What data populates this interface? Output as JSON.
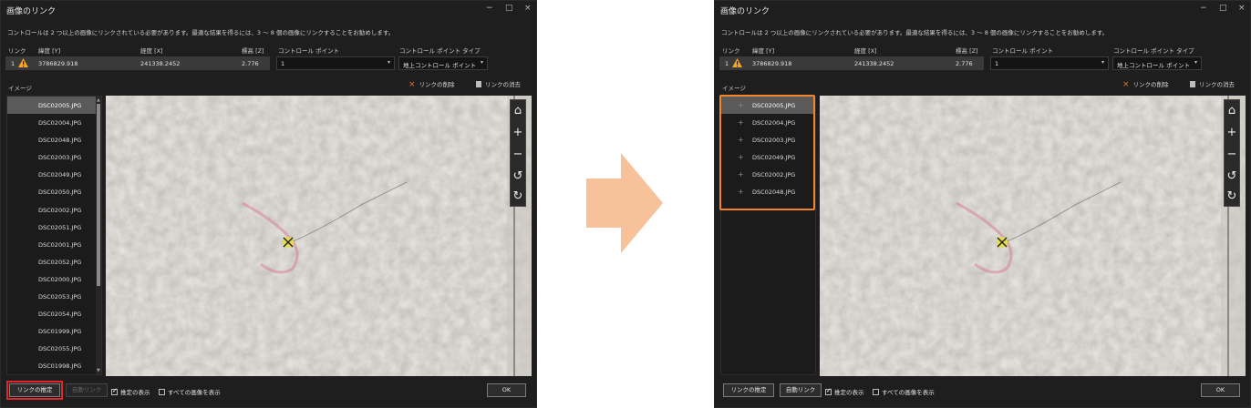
{
  "dialog": {
    "title": "画像のリンク",
    "window_controls": {
      "minimize": "−",
      "maximize": "□",
      "close": "×"
    },
    "info_text": "コントロールは 2 つ以上の画像にリンクされている必要があります。最適な結果を得るには、3 〜 8 個の画像にリンクすることをお勧めします。",
    "columns": {
      "link": "リンク",
      "lat": "緯度 [Y]",
      "lon": "経度 [X]",
      "elev": "標高 [Z]",
      "point": "コントロール ポイント",
      "type": "コントロール ポイント タイプ"
    },
    "row": {
      "link": "1",
      "lat": "3786829.918",
      "lon": "241338.2452",
      "elev": "2.776",
      "point": "1",
      "type": "地上コントロール ポイント"
    },
    "images_label": "イメージ",
    "remove_link": "リンクの削除",
    "clear_links": "リンクの消去",
    "estimate_button": "リンクの推定",
    "auto_link_button": "自動リンク",
    "show_estimate": "推定の表示",
    "show_all_images": "すべての画像を表示",
    "ok_button": "OK",
    "tools": {
      "home": "⌂",
      "zoom_in": "+",
      "zoom_out": "−",
      "rotate_left": "↺",
      "rotate_right": "↻"
    }
  },
  "left_images": [
    "DSC02005.JPG",
    "DSC02004.JPG",
    "DSC02048.JPG",
    "DSC02003.JPG",
    "DSC02049.JPG",
    "DSC02050.JPG",
    "DSC02002.JPG",
    "DSC02051.JPG",
    "DSC02001.JPG",
    "DSC02052.JPG",
    "DSC02000.JPG",
    "DSC02053.JPG",
    "DSC02054.JPG",
    "DSC01999.JPG",
    "DSC02055.JPG",
    "DSC01998.JPG"
  ],
  "right_images": [
    "DSC02005.JPG",
    "DSC02004.JPG",
    "DSC02003.JPG",
    "DSC02049.JPG",
    "DSC02002.JPG",
    "DSC02048.JPG"
  ],
  "colors": {
    "highlight_red": "#e5232b",
    "highlight_orange": "#f1842c",
    "arrow": "#f7c29a",
    "warning": "#f5a623"
  }
}
